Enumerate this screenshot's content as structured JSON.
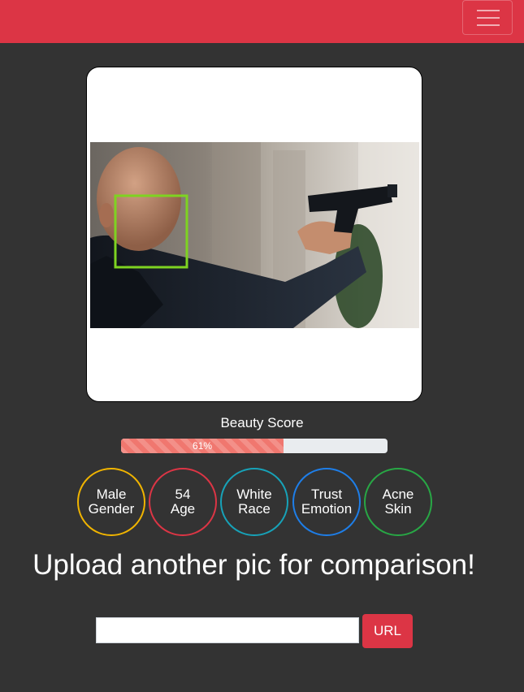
{
  "colors": {
    "navbar": "#dc3545",
    "background": "#333333",
    "progress_fill": "#f0776f",
    "face_box": "#7ed321"
  },
  "navbar": {
    "menu_icon": "hamburger-icon"
  },
  "beauty_score": {
    "label": "Beauty Score",
    "percent_text": "61%",
    "percent": 61
  },
  "attributes": [
    {
      "value": "Male",
      "label": "Gender",
      "color": "#f0b400"
    },
    {
      "value": "54",
      "label": "Age",
      "color": "#dc3545"
    },
    {
      "value": "White",
      "label": "Race",
      "color": "#17a2b8"
    },
    {
      "value": "Trust",
      "label": "Emotion",
      "color": "#1e7ee8"
    },
    {
      "value": "Acne",
      "label": "Skin",
      "color": "#28a745"
    }
  ],
  "upload": {
    "headline": "Upload another pic for comparison!",
    "url_value": "",
    "url_button": "URL"
  }
}
